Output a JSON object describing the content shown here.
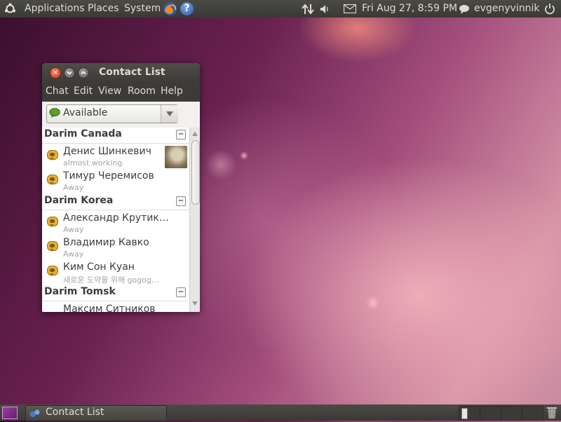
{
  "top_panel": {
    "menus": [
      "Applications",
      "Places",
      "System"
    ],
    "datetime": "Fri Aug 27,  8:59 PM",
    "username": "evgenyvinnik",
    "icons": [
      "ubuntu-logo-icon",
      "firefox-icon",
      "help-icon",
      "network-icon",
      "volume-icon",
      "mail-icon",
      "user-status-icon",
      "power-icon"
    ]
  },
  "window": {
    "title": "Contact List",
    "menu": [
      "Chat",
      "Edit",
      "View",
      "Room",
      "Help"
    ],
    "status": "Available",
    "groups": [
      {
        "name": "Darim Canada",
        "contacts": [
          {
            "name": "Денис Шинкевич",
            "status": "almost working",
            "has_avatar": true
          },
          {
            "name": "Тимур Черемисов",
            "status": "Away"
          }
        ]
      },
      {
        "name": "Darim Korea",
        "contacts": [
          {
            "name": "Александр Крутик…",
            "status": "Away"
          },
          {
            "name": "Владимир Кавко",
            "status": "Away"
          },
          {
            "name": "Ким Сон Куан",
            "status": "새로운 도약을 위해 gogog…"
          }
        ]
      },
      {
        "name": "Darim Tomsk",
        "contacts": [
          {
            "name": "Максим Ситников",
            "status": ""
          }
        ]
      }
    ],
    "collapse_symbol": "−"
  },
  "bottom_panel": {
    "task_label": "Contact List"
  },
  "colors": {
    "panel": "#3c3b37",
    "panel_text": "#dfdbd2",
    "available_green": "#5aa02c",
    "away_orange": "#e8b032"
  }
}
